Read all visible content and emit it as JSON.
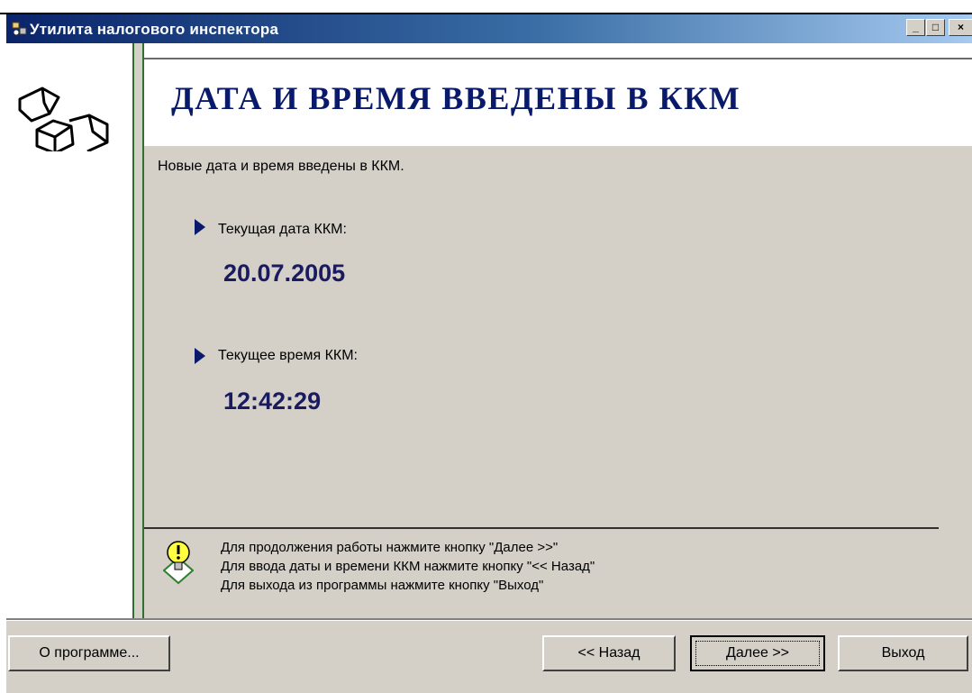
{
  "window": {
    "title": "Утилита налогового инспектора"
  },
  "titlebar_buttons": {
    "minimize_label": "_",
    "maximize_label": "□",
    "close_label": "×"
  },
  "header": {
    "title": "ДАТА И ВРЕМЯ ВВЕДЕНЫ В ККМ"
  },
  "content": {
    "intro": "Новые дата и время введены в ККМ.",
    "date_label": "Текущая дата ККМ:",
    "date_value": "20.07.2005",
    "time_label": "Текущее время  ККМ:",
    "time_value": "12:42:29"
  },
  "hints": [
    "Для продолжения работы нажмите кнопку \"Далее >>\"",
    "Для ввода даты и времени ККМ нажмите кнопку \"<< Назад\"",
    "Для выхода из программы нажмите кнопку \"Выход\""
  ],
  "buttons": {
    "about": "О программе...",
    "back": "<< Назад",
    "next": "Далее >>",
    "exit": "Выход"
  },
  "icons": {
    "logo": "cube-outline-logo",
    "hint": "lightbulb-icon",
    "bullet": "triangle-bullet-icon"
  },
  "colors": {
    "accent": "#0a1a6a",
    "title_gradient_start": "#0a246a",
    "panel_background": "#d4d0c8",
    "divider_green": "#2f6f2f"
  }
}
